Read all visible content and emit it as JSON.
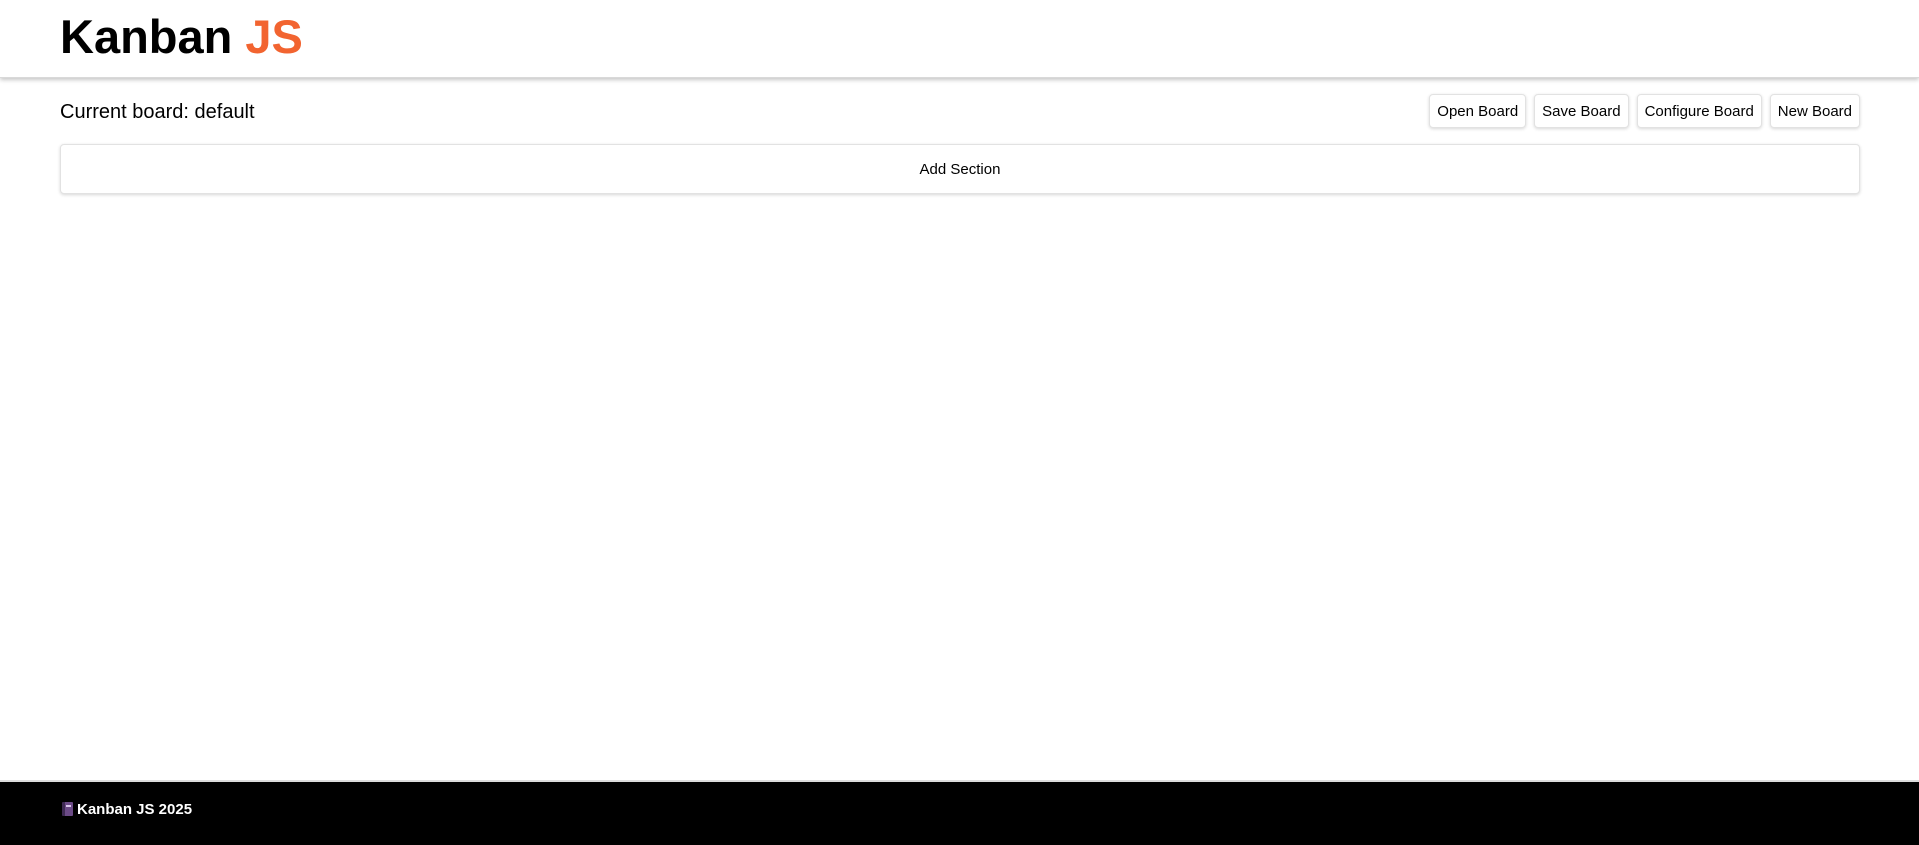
{
  "header": {
    "logo_main": "Kanban",
    "logo_accent": "JS"
  },
  "toolbar": {
    "current_board_label": "Current board: default",
    "buttons": {
      "open": "Open Board",
      "save": "Save Board",
      "configure": "Configure Board",
      "new": "New Board"
    }
  },
  "board": {
    "add_section_label": "Add Section"
  },
  "footer": {
    "icon": "notebook-icon",
    "text": "Kanban JS 2025"
  },
  "colors": {
    "accent": "#f26430",
    "footer_bg": "#000000",
    "footer_text": "#ffffff"
  }
}
